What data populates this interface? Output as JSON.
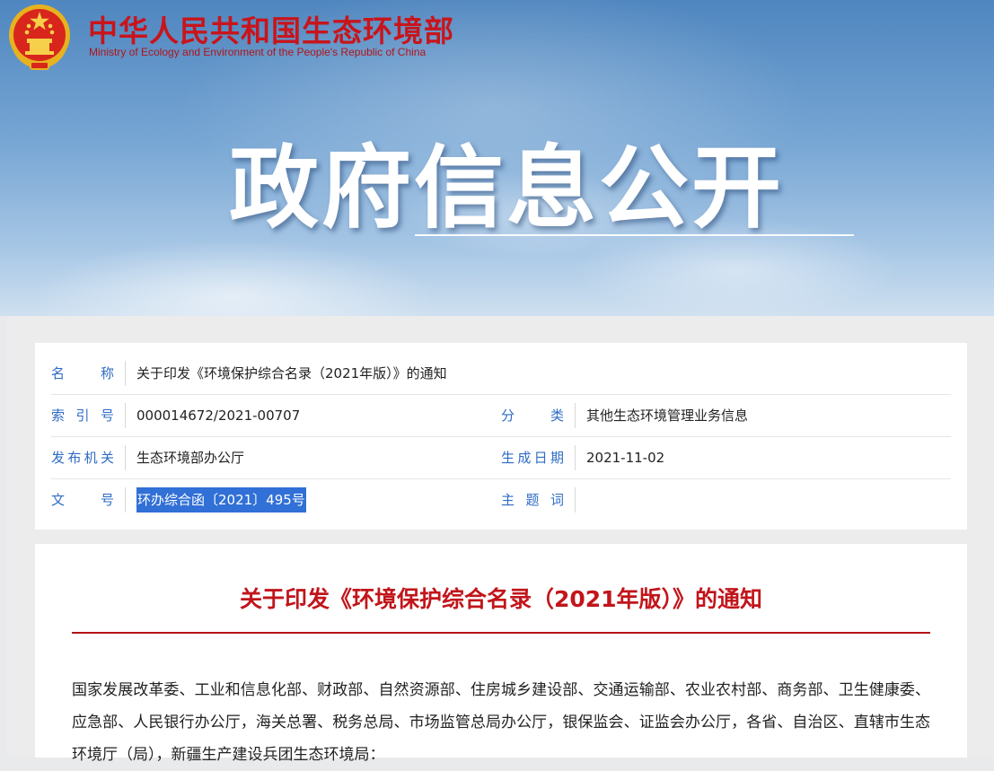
{
  "header": {
    "site_name_cn": "中华人民共和国生态环境部",
    "site_name_en": "Ministry of Ecology and Environment of the People's Republic of China",
    "emblem_icon": "national-emblem-icon",
    "banner_title": "政府信息公开"
  },
  "meta": {
    "name_label": "名　称",
    "name_value": "关于印发《环境保护综合名录（2021年版）》的通知",
    "index_label": "索引号",
    "index_value": "000014672/2021-00707",
    "category_label": "分　类",
    "category_value": "其他生态环境管理业务信息",
    "publisher_label": "发布机关",
    "publisher_value": "生态环境部办公厅",
    "date_label": "生成日期",
    "date_value": "2021-11-02",
    "docno_label": "文　号",
    "docno_value": "环办综合函〔2021〕495号",
    "keywords_label": "主题词",
    "keywords_value": ""
  },
  "article": {
    "title": "关于印发《环境保护综合名录（2021年版）》的通知",
    "body": "国家发展改革委、工业和信息化部、财政部、自然资源部、住房城乡建设部、交通运输部、农业农村部、商务部、卫生健康委、应急部、人民银行办公厅，海关总署、税务总局、市场监管总局办公厅，银保监会、证监会办公厅，各省、自治区、直辖市生态环境厅（局），新疆生产建设兵团生态环境局："
  },
  "colors": {
    "brand_red": "#c8151c",
    "label_blue": "#2f6cc5",
    "selection_blue": "#3170d6"
  }
}
